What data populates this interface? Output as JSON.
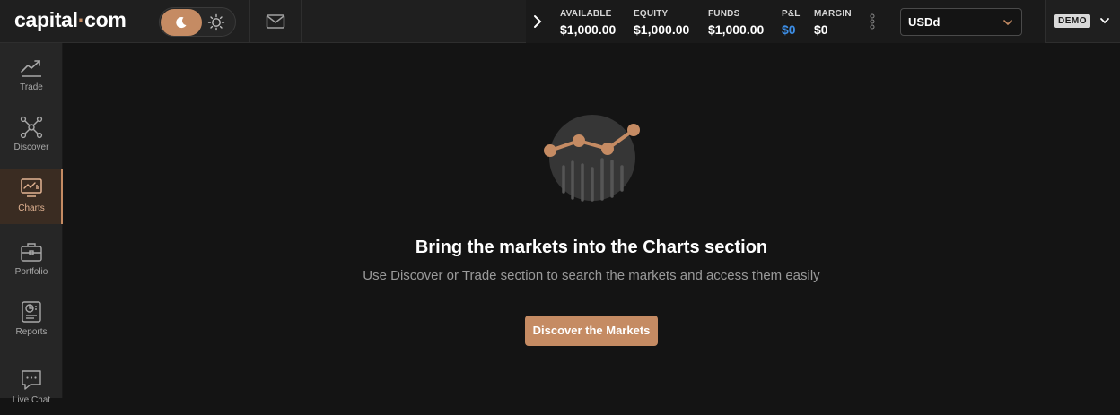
{
  "brand": {
    "name_left": "capital",
    "name_dot": "·",
    "name_right": "com",
    "accent": "#c58b63"
  },
  "header": {
    "theme": {
      "active": "dark"
    },
    "account": {
      "metrics": [
        {
          "label": "AVAILABLE",
          "value": "$1,000.00"
        },
        {
          "label": "EQUITY",
          "value": "$1,000.00"
        },
        {
          "label": "FUNDS",
          "value": "$1,000.00"
        },
        {
          "label": "P&L",
          "value": "$0"
        },
        {
          "label": "MARGIN",
          "value": "$0"
        }
      ],
      "currency": "USDd",
      "mode_badge": "DEMO"
    }
  },
  "sidebar": {
    "items": [
      {
        "label": "Trade",
        "icon": "trend-chart-icon"
      },
      {
        "label": "Discover",
        "icon": "network-nodes-icon"
      },
      {
        "label": "Charts",
        "icon": "chart-monitor-icon",
        "active": true
      },
      {
        "label": "Portfolio",
        "icon": "briefcase-icon"
      },
      {
        "label": "Reports",
        "icon": "report-icon"
      },
      {
        "label": "Live Chat",
        "icon": "chat-bubble-icon"
      }
    ]
  },
  "main": {
    "title": "Bring the markets into the Charts section",
    "subtitle": "Use Discover or Trade section to search the markets and access them easily",
    "cta_label": "Discover the Markets"
  },
  "colors": {
    "pnl_blue": "#3d8fe8",
    "active_label": "#e3b493"
  }
}
